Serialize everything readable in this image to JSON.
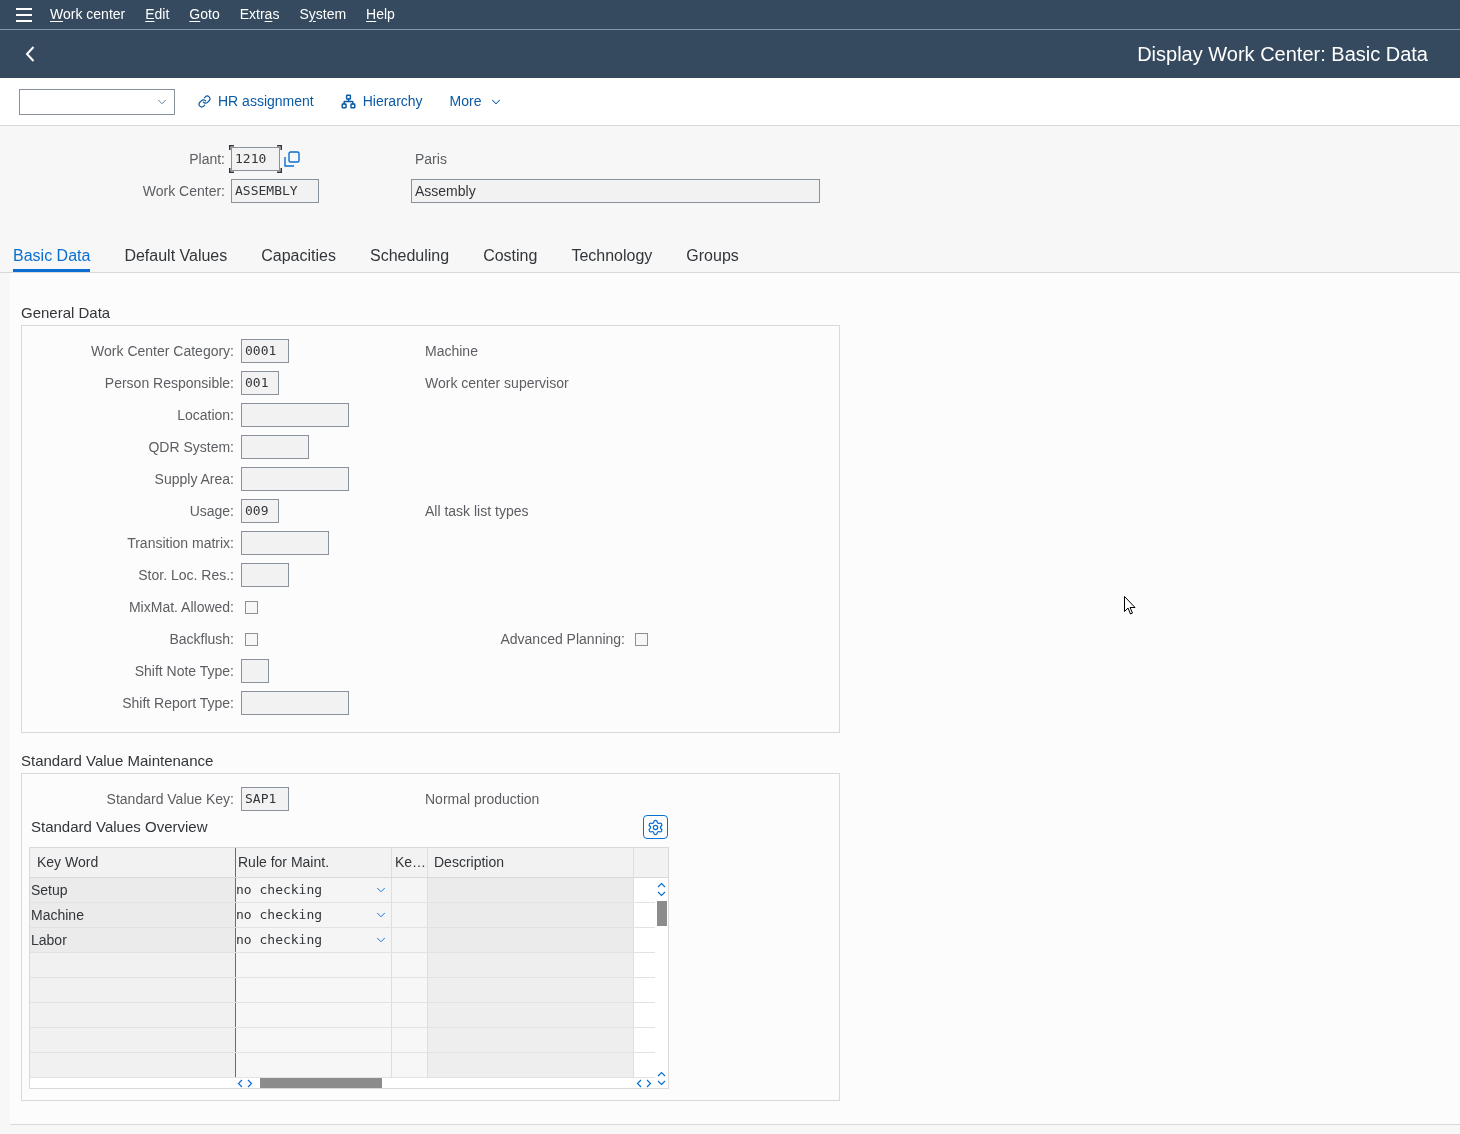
{
  "menu_bar": {
    "items": [
      {
        "access_key": "W",
        "after": "ork center"
      },
      {
        "access_key": "E",
        "after": "dit"
      },
      {
        "access_key": "G",
        "after": "oto"
      },
      {
        "before": "Extr",
        "access_key": "a",
        "after": "s"
      },
      {
        "before": "S",
        "access_key": "y",
        "after": "stem"
      },
      {
        "access_key": "H",
        "after": "elp"
      }
    ]
  },
  "title_bar": {
    "title": "Display Work Center: Basic Data"
  },
  "toolbar": {
    "actions": [
      {
        "kind": "link",
        "label": "HR assignment"
      },
      {
        "kind": "hierarchy",
        "label": "Hierarchy"
      },
      {
        "kind": "menu",
        "label": "More"
      }
    ]
  },
  "header_fields": [
    {
      "label": "Plant:",
      "value": "1210",
      "focused": true,
      "value_help": true,
      "description": {
        "kind": "text",
        "text": "Paris"
      }
    },
    {
      "label": "Work Center:",
      "value": "ASSEMBLY",
      "focused": false,
      "value_help": false,
      "description": {
        "kind": "field",
        "text": "Assembly"
      }
    }
  ],
  "tabs": [
    {
      "label": "Basic Data",
      "selected": true
    },
    {
      "label": "Default Values",
      "selected": false
    },
    {
      "label": "Capacities",
      "selected": false
    },
    {
      "label": "Scheduling",
      "selected": false
    },
    {
      "label": "Costing",
      "selected": false
    },
    {
      "label": "Technology",
      "selected": false
    },
    {
      "label": "Groups",
      "selected": false
    }
  ],
  "general_data": {
    "title": "General Data",
    "rows": [
      {
        "kind": "field",
        "label": "Work Center Category:",
        "value": "0001",
        "description": "Machine"
      },
      {
        "kind": "field",
        "label": "Person Responsible:",
        "value": "001",
        "description": "Work center supervisor"
      },
      {
        "kind": "field",
        "label": "Location:"
      },
      {
        "kind": "field",
        "label": "QDR System:"
      },
      {
        "kind": "field",
        "label": "Supply Area:"
      },
      {
        "kind": "field",
        "label": "Usage:",
        "value": "009",
        "description": "All task list types"
      },
      {
        "kind": "field",
        "label": "Transition matrix:"
      },
      {
        "kind": "field",
        "label": "Stor. Loc. Res.:"
      },
      {
        "kind": "checkbox",
        "label": "MixMat. Allowed:",
        "checked": false
      },
      {
        "kind": "checkbox",
        "label": "Backflush:",
        "checked": false,
        "extra": {
          "label": "Advanced Planning:",
          "checked": false
        }
      },
      {
        "kind": "field",
        "label": "Shift Note Type:"
      },
      {
        "kind": "field",
        "label": "Shift Report Type:"
      }
    ]
  },
  "standard_value_maintenance": {
    "title": "Standard Value Maintenance",
    "key": {
      "label": "Standard Value Key:",
      "value": "SAP1",
      "description": "Normal production"
    },
    "overview": {
      "title": "Standard Values Overview",
      "columns": [
        "Key Word",
        "Rule for Maint.",
        "Ke…",
        "Description"
      ],
      "rows": [
        {
          "key_word": "Setup",
          "rule": "no checking"
        },
        {
          "key_word": "Machine",
          "rule": "no checking"
        },
        {
          "key_word": "Labor",
          "rule": "no checking"
        }
      ]
    }
  }
}
